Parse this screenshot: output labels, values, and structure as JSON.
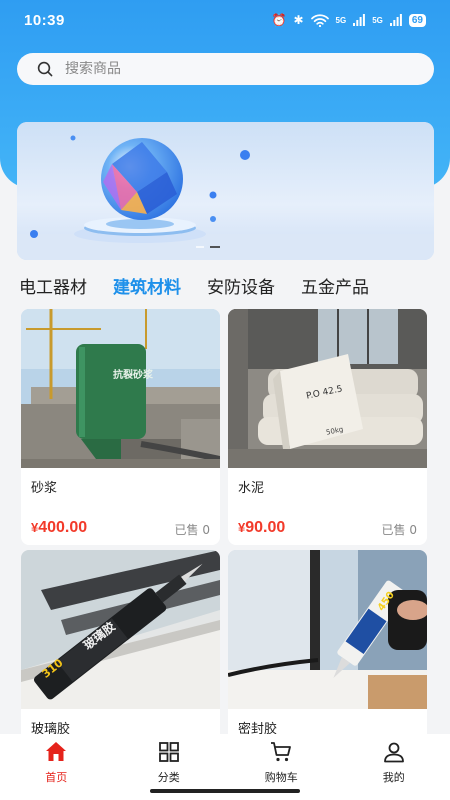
{
  "status_bar": {
    "time": "10:39",
    "alarm_icon": "⏰",
    "bluetooth_icon": "✱",
    "wifi_icon": "wifi-icon",
    "signal_1": "5G",
    "signal_2": "5G",
    "battery": "69"
  },
  "search": {
    "placeholder": "搜索商品",
    "icon": "search-icon"
  },
  "banner": {
    "slides": 2,
    "active_slide": 2
  },
  "category_tabs": [
    {
      "label": "电工器材",
      "active": false
    },
    {
      "label": "建筑材料",
      "active": true
    },
    {
      "label": "安防设备",
      "active": false
    },
    {
      "label": "五金产品",
      "active": false
    }
  ],
  "products": [
    {
      "name": "砂浆",
      "currency": "¥",
      "price": "400.00",
      "sold": "已售 0",
      "image": "mortar-silo",
      "image_text": "抗裂砂浆"
    },
    {
      "name": "水泥",
      "currency": "¥",
      "price": "90.00",
      "sold": "已售 0",
      "image": "cement-bags",
      "image_text": "P.O 42.5",
      "image_text_2": "50kg"
    },
    {
      "name": "玻璃胶",
      "image": "glass-glue-tube",
      "image_text": "玻璃胶",
      "image_text_2": "310"
    },
    {
      "name": "密封胶",
      "image": "sealant-gun",
      "image_text": "450"
    }
  ],
  "bottom_nav": [
    {
      "label": "首页",
      "icon": "home-icon",
      "active": true
    },
    {
      "label": "分类",
      "icon": "grid-icon",
      "active": false
    },
    {
      "label": "购物车",
      "icon": "cart-icon",
      "active": false
    },
    {
      "label": "我的",
      "icon": "user-icon",
      "active": false
    }
  ],
  "colors": {
    "header": "#2f9df2",
    "active_tab": "#1e90ea",
    "price": "#f23a2a",
    "nav_active": "#e5231b"
  }
}
